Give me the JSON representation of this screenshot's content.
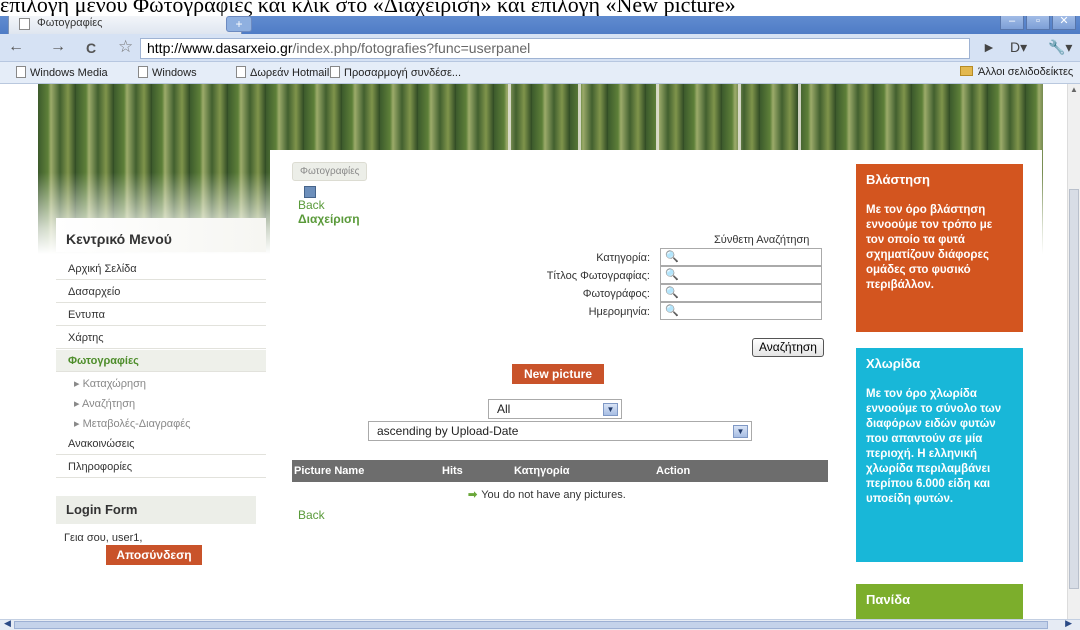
{
  "caption": "επιλογή μενού Φωτογραφίες και κλικ στο «Διαχείριση» και επιλογή «New picture»",
  "browser": {
    "tab_title": "Φωτογραφίες",
    "tab_close": "×",
    "new_tab": "+",
    "url_host": "http://www.dasarxeio.gr",
    "url_path": "/index.php/fotografies?func=userpanel",
    "bookmarks": [
      "Windows Media",
      "Windows",
      "Δωρεάν Hotmail",
      "Προσαρμογή συνδέσε..."
    ],
    "other_bookmarks": "Άλλοι σελιδοδείκτες",
    "nav": {
      "back": "←",
      "forward": "→",
      "reload": "C",
      "star": "☆",
      "go": "►",
      "page": "D▾",
      "tools": "🔧▾"
    },
    "window_buttons": {
      "minimize": "–",
      "restore": "▫",
      "close": "✕"
    }
  },
  "page": {
    "breadcrumb": "Φωτογραφίες",
    "back_link": "Back",
    "manage_link": "Διαχείριση",
    "advanced_search": "Σύνθετη Αναζήτηση",
    "search_fields": [
      {
        "label": "Κατηγορία:",
        "value": ""
      },
      {
        "label": "Τίτλος Φωτογραφίας:",
        "value": ""
      },
      {
        "label": "Φωτογράφος:",
        "value": ""
      },
      {
        "label": "Ημερομηνία:",
        "value": ""
      }
    ],
    "search_button": "Αναζήτηση",
    "new_picture_button": "New picture",
    "filter_select": "All",
    "sort_select": "ascending by Upload-Date",
    "table_headers": [
      "Picture Name",
      "Hits",
      "Κατηγορία",
      "Action"
    ],
    "empty_message": "You do not have any pictures.",
    "back_bottom": "Back"
  },
  "sidebar": {
    "menu_title": "Κεντρικό Μενού",
    "items": [
      "Αρχική Σελίδα",
      "Δασαρχείο",
      "Εντυπα",
      "Χάρτης",
      "Φωτογραφίες"
    ],
    "subitems": [
      "Καταχώρηση",
      "Αναζήτηση",
      "Μεταβολές-Διαγραφές"
    ],
    "items_after": [
      "Ανακοινώσεις",
      "Πληροφορίες"
    ],
    "login_title": "Login Form",
    "greeting": "Γεια σου, user1,",
    "logout_button": "Αποσύνδεση"
  },
  "right_boxes": [
    {
      "title": "Βλάστηση",
      "text": "Με τον όρο βλάστηση εννοούμε τον τρόπο με τον οποίο τα φυτά σχηματίζουν διάφορες ομάδες στο φυσικό περιβάλλον.",
      "color": "#d3551f"
    },
    {
      "title": "Χλωρίδα",
      "text": "Με τον όρο χλωρίδα εννοούμε το σύνολο των διαφόρων ειδών φυτών που απαντούν σε μία περιοχή. Η ελληνική χλωρίδα περιλαμβάνει περίπου 6.000 είδη και υποείδη φυτών.",
      "color": "#18b7d8"
    },
    {
      "title": "Πανίδα",
      "text": "",
      "color": "#7cae2c"
    }
  ],
  "colors": {
    "accent_orange": "#c9532a",
    "link_green": "#5a9a3a"
  }
}
